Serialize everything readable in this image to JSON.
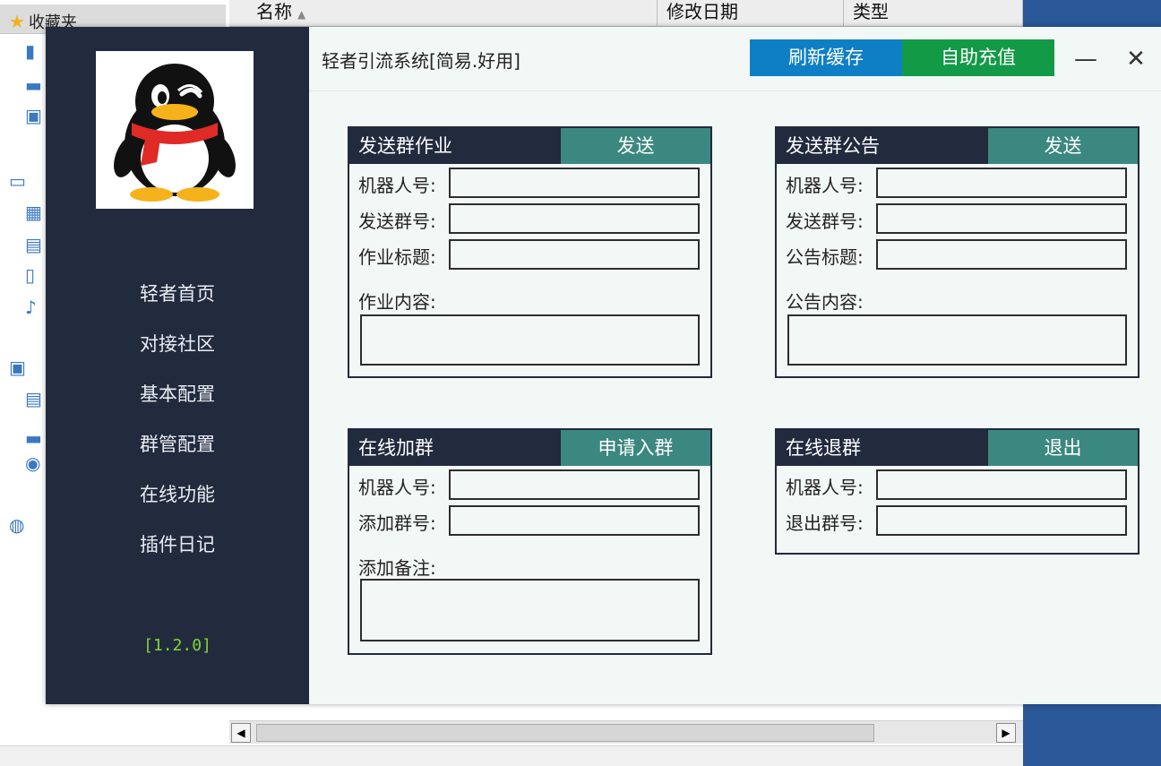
{
  "background": {
    "favorites_label": "收藏夹",
    "columns": [
      "名称",
      "修改日期",
      "类型"
    ]
  },
  "app": {
    "title": "轻者引流系统[简易.好用]",
    "refresh_label": "刷新缓存",
    "recharge_label": "自助充值",
    "minimize_glyph": "—",
    "close_glyph": "✕",
    "nav": [
      "轻者首页",
      "对接社区",
      "基本配置",
      "群管配置",
      "在线功能",
      "插件日记"
    ],
    "version": "[1.2.0]",
    "panels": {
      "homework": {
        "title": "发送群作业",
        "action": "发送",
        "fields": [
          "机器人号:",
          "发送群号:",
          "作业标题:"
        ],
        "area_label": "作业内容:"
      },
      "notice": {
        "title": "发送群公告",
        "action": "发送",
        "fields": [
          "机器人号:",
          "发送群号:",
          "公告标题:"
        ],
        "area_label": "公告内容:"
      },
      "join": {
        "title": "在线加群",
        "action": "申请入群",
        "fields": [
          "机器人号:",
          "添加群号:"
        ],
        "area_label": "添加备注:"
      },
      "quit": {
        "title": "在线退群",
        "action": "退出",
        "fields": [
          "机器人号:",
          "退出群号:"
        ]
      }
    }
  },
  "colors": {
    "sidebar": "#222a3e",
    "accent_blue": "#0f7fc5",
    "accent_green": "#139a47",
    "panel_action": "#3b8880",
    "version_text": "#7fd63a"
  }
}
